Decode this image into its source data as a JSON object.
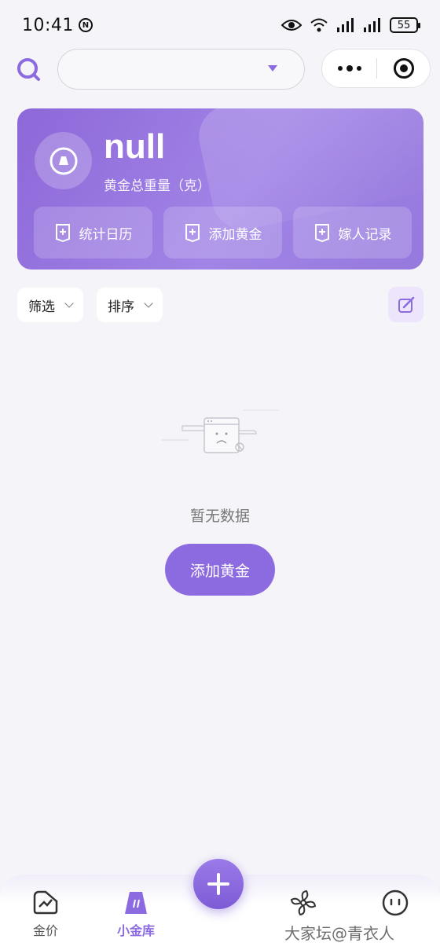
{
  "status_bar": {
    "time": "10:41",
    "battery": "55"
  },
  "header": {
    "search_value": ""
  },
  "hero": {
    "title": "null",
    "subtitle": "黄金总重量（克）",
    "actions": [
      {
        "label": "统计日历",
        "icon": "calendar-doc-icon"
      },
      {
        "label": "添加黄金",
        "icon": "add-doc-icon"
      },
      {
        "label": "嫁人记录",
        "icon": "record-doc-icon"
      }
    ]
  },
  "filters": {
    "filter_label": "筛选",
    "sort_label": "排序"
  },
  "empty": {
    "text": "暂无数据",
    "button_label": "添加黄金"
  },
  "tabbar": {
    "tabs": [
      {
        "label": "金价",
        "icon": "price-trend-icon",
        "active": false
      },
      {
        "label": "小金库",
        "icon": "vault-icon",
        "active": true
      },
      {
        "label": "",
        "icon": "fan-icon",
        "active": false
      },
      {
        "label": "",
        "icon": "chat-face-icon",
        "active": false
      }
    ]
  },
  "watermark": "大家坛@青衣人",
  "colors": {
    "accent": "#8c6ae0",
    "background": "#f5f5f9",
    "hero_gradient_start": "#8d68d9",
    "hero_gradient_end": "#9679dd"
  }
}
